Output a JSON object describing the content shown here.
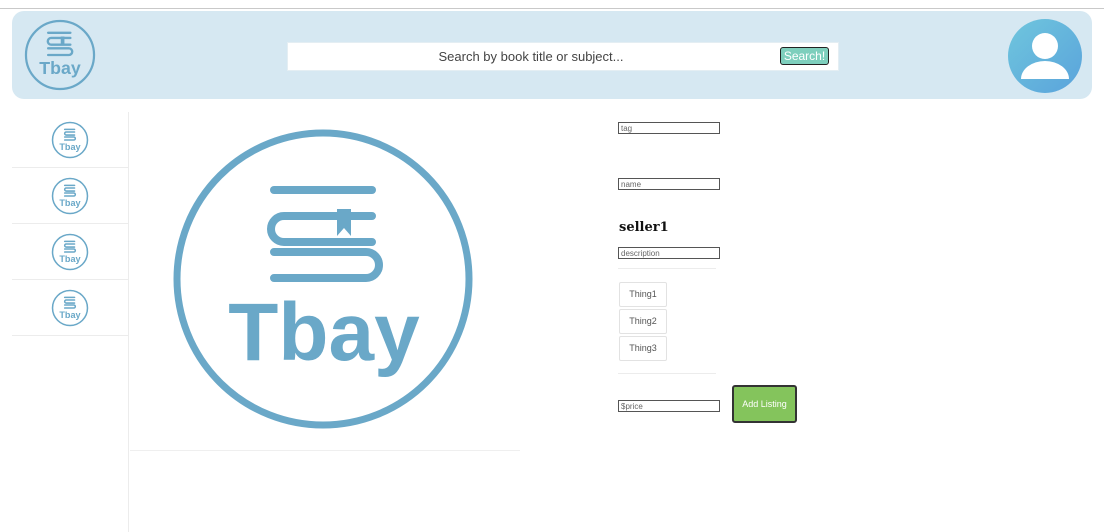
{
  "header": {
    "logo_text": "Tbay",
    "search": {
      "placeholder": "Search by book title or subject...",
      "button_label": "Search!"
    }
  },
  "sidebar": {
    "items": [
      {
        "logo_text": "Tbay"
      },
      {
        "logo_text": "Tbay"
      },
      {
        "logo_text": "Tbay"
      },
      {
        "logo_text": "Tbay"
      }
    ]
  },
  "listing": {
    "image_logo_text": "Tbay",
    "tag_placeholder": "tag",
    "name_placeholder": "name",
    "seller": "seller1",
    "description_placeholder": "description",
    "things": [
      "Thing1",
      "Thing2",
      "Thing3"
    ],
    "price_placeholder": "$price",
    "add_button_label": "Add Listing"
  },
  "colors": {
    "header_bg": "#d6e8f2",
    "logo_blue": "#6aa8c8",
    "search_button": "#7ecfbd",
    "add_button": "#84c45c"
  }
}
